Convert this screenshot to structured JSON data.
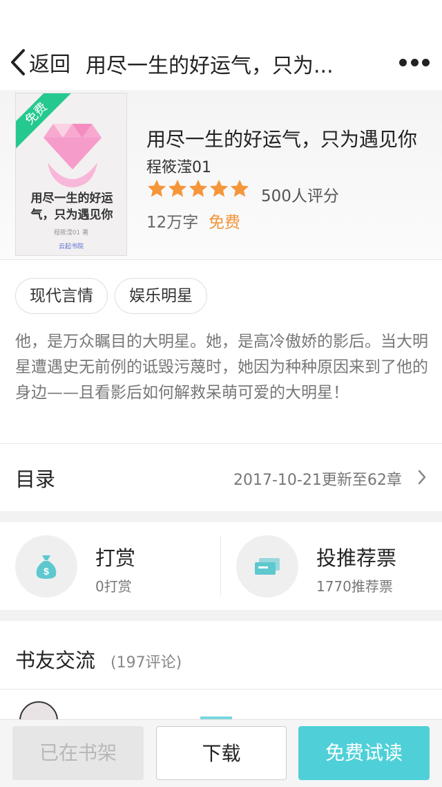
{
  "nav": {
    "back_label": "返回",
    "title": "用尽一生的好运气，只为..."
  },
  "book": {
    "title": "用尽一生的好运气，只为遇见你",
    "author": "程筱滢01",
    "rating_stars": 5,
    "rating_count": "500人评分",
    "word_count": "12万字",
    "price": "免费",
    "cover": {
      "badge": "免费",
      "title": "用尽一生的好运气，只为遇见你",
      "author": "程筱滢01 著",
      "publisher": "云起书院"
    }
  },
  "tags": [
    "现代言情",
    "娱乐明星"
  ],
  "description": "他，是万众瞩目的大明星。她，是高冷傲娇的影后。当大明星遭遇史无前例的诋毁污蔑时，她因为种种原因来到了他的身边——且看影后如何解救呆萌可爱的大明星！",
  "toc": {
    "label": "目录",
    "update": "2017-10-21更新至62章"
  },
  "actions": {
    "reward": {
      "title": "打赏",
      "sub": "0打赏"
    },
    "vote": {
      "title": "投推荐票",
      "sub": "1770推荐票"
    }
  },
  "community": {
    "title": "书友交流",
    "count": "(197评论)"
  },
  "bottom": {
    "shelf": "已在书架",
    "download": "下载",
    "read": "免费试读"
  },
  "colors": {
    "accent": "#4fd0d8",
    "star": "#f5963a",
    "price": "#f2943a",
    "badge": "#25c98f"
  }
}
